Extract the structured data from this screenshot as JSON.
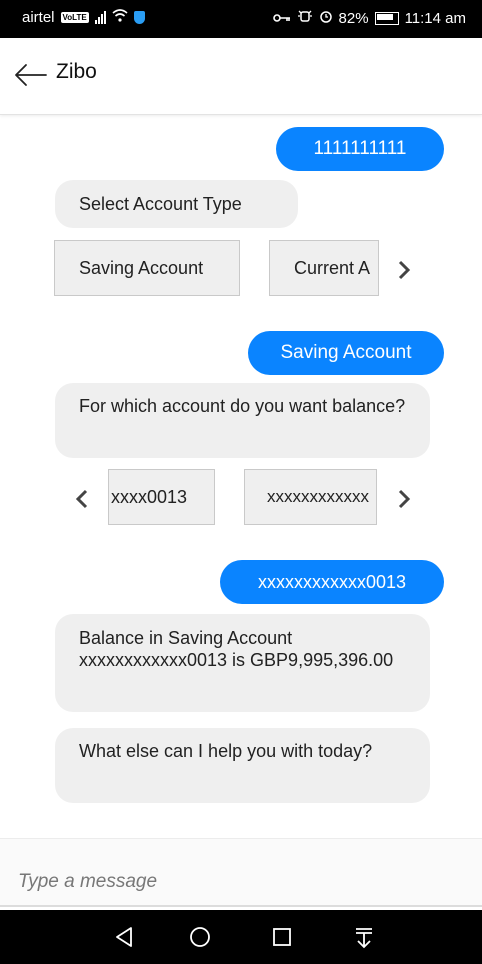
{
  "status_bar": {
    "carrier": "airtel",
    "volte": "VoLTE",
    "battery": "82%",
    "time": "11:14 am"
  },
  "header": {
    "title": "Zibo"
  },
  "chat": {
    "msg1": "1111111111",
    "prompt1": "Select Account Type",
    "account_types": [
      "Saving Account",
      "Current A"
    ],
    "msg2": "Saving Account",
    "prompt2": "For which account do you want balance?",
    "accounts": [
      "xxxx0013",
      "xxxxxxxxxxxx"
    ],
    "msg3": "xxxxxxxxxxxx0013",
    "balance_reply": "Balance in Saving Account xxxxxxxxxxxx0013 is GBP9,995,396.00",
    "followup": "What else can I help you with today?"
  },
  "input": {
    "placeholder": "Type a message"
  }
}
